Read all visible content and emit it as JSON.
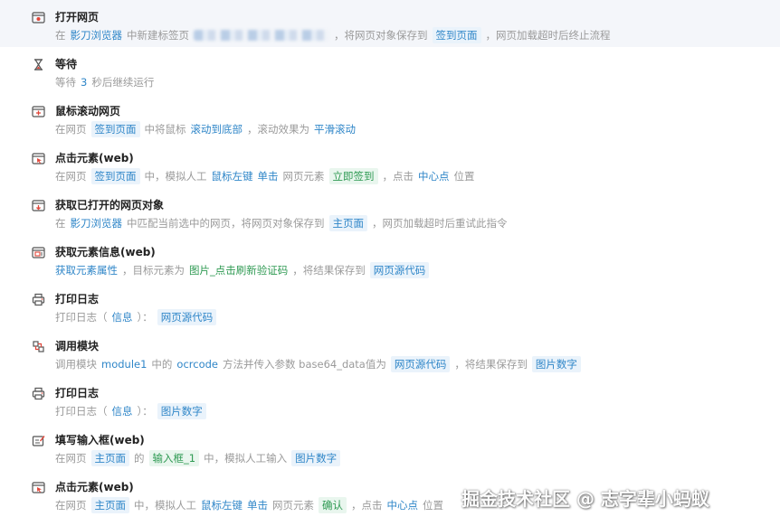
{
  "steps": [
    {
      "title": "打开网页",
      "icon": "browser-open-icon",
      "selected": true,
      "desc": [
        {
          "t": "txt",
          "v": "在"
        },
        {
          "t": "val",
          "v": "影刀浏览器"
        },
        {
          "t": "txt",
          "v": "中新建标签页"
        },
        {
          "t": "blur",
          "v": ""
        },
        {
          "t": "txt",
          "v": "，将网页对象保存到"
        },
        {
          "t": "chip",
          "v": "签到页面"
        },
        {
          "t": "txt",
          "v": "，网页加载超时后终止流程"
        }
      ]
    },
    {
      "title": "等待",
      "icon": "hourglass-icon",
      "desc": [
        {
          "t": "txt",
          "v": "等待"
        },
        {
          "t": "val",
          "v": "3"
        },
        {
          "t": "txt",
          "v": "秒后继续运行"
        }
      ]
    },
    {
      "title": "鼠标滚动网页",
      "icon": "scroll-page-icon",
      "desc": [
        {
          "t": "txt",
          "v": "在网页"
        },
        {
          "t": "chip",
          "v": "签到页面"
        },
        {
          "t": "txt",
          "v": "中将鼠标"
        },
        {
          "t": "val",
          "v": "滚动到底部"
        },
        {
          "t": "txt",
          "v": "，滚动效果为"
        },
        {
          "t": "val",
          "v": "平滑滚动"
        }
      ]
    },
    {
      "title": "点击元素(web)",
      "icon": "click-element-icon",
      "desc": [
        {
          "t": "txt",
          "v": "在网页"
        },
        {
          "t": "chip",
          "v": "签到页面"
        },
        {
          "t": "txt",
          "v": "中，模拟人工"
        },
        {
          "t": "val",
          "v": "鼠标左键"
        },
        {
          "t": "val",
          "v": "单击"
        },
        {
          "t": "txt",
          "v": "网页元素"
        },
        {
          "t": "chipg",
          "v": "立即签到"
        },
        {
          "t": "txt",
          "v": "，点击"
        },
        {
          "t": "val",
          "v": "中心点"
        },
        {
          "t": "txt",
          "v": "位置"
        }
      ]
    },
    {
      "title": "获取已打开的网页对象",
      "icon": "get-page-icon",
      "desc": [
        {
          "t": "txt",
          "v": "在"
        },
        {
          "t": "val",
          "v": "影刀浏览器"
        },
        {
          "t": "txt",
          "v": "中匹配当前选中的网页，将网页对象保存到"
        },
        {
          "t": "chip",
          "v": "主页面"
        },
        {
          "t": "txt",
          "v": "，网页加载超时后重试此指令"
        }
      ]
    },
    {
      "title": "获取元素信息(web)",
      "icon": "element-info-icon",
      "desc": [
        {
          "t": "val",
          "v": "获取元素属性"
        },
        {
          "t": "txt",
          "v": "，目标元素为"
        },
        {
          "t": "greentext",
          "v": "图片_点击刷新验证码"
        },
        {
          "t": "txt",
          "v": "，将结果保存到"
        },
        {
          "t": "chip",
          "v": "网页源代码"
        }
      ]
    },
    {
      "title": "打印日志",
      "icon": "printer-icon",
      "desc": [
        {
          "t": "txt",
          "v": "打印日志（"
        },
        {
          "t": "val",
          "v": "信息"
        },
        {
          "t": "txt",
          "v": "）："
        },
        {
          "t": "chip",
          "v": "网页源代码"
        }
      ]
    },
    {
      "title": "调用模块",
      "icon": "module-icon",
      "desc": [
        {
          "t": "txt",
          "v": "调用模块"
        },
        {
          "t": "val",
          "v": "module1"
        },
        {
          "t": "txt",
          "v": "中的"
        },
        {
          "t": "val",
          "v": "ocrcode"
        },
        {
          "t": "txt",
          "v": "方法并传入参数 base64_data值为"
        },
        {
          "t": "chip",
          "v": "网页源代码"
        },
        {
          "t": "txt",
          "v": "，将结果保存到"
        },
        {
          "t": "chip",
          "v": "图片数字"
        }
      ]
    },
    {
      "title": "打印日志",
      "icon": "printer-icon",
      "desc": [
        {
          "t": "txt",
          "v": "打印日志（"
        },
        {
          "t": "val",
          "v": "信息"
        },
        {
          "t": "txt",
          "v": "）："
        },
        {
          "t": "chip",
          "v": "图片数字"
        }
      ]
    },
    {
      "title": "填写输入框(web)",
      "icon": "edit-input-icon",
      "desc": [
        {
          "t": "txt",
          "v": "在网页"
        },
        {
          "t": "chip",
          "v": "主页面"
        },
        {
          "t": "txt",
          "v": "的"
        },
        {
          "t": "chipg",
          "v": "输入框_1"
        },
        {
          "t": "txt",
          "v": "中，模拟人工输入"
        },
        {
          "t": "chip",
          "v": "图片数字"
        }
      ]
    },
    {
      "title": "点击元素(web)",
      "icon": "click-element-icon",
      "desc": [
        {
          "t": "txt",
          "v": "在网页"
        },
        {
          "t": "chip",
          "v": "主页面"
        },
        {
          "t": "txt",
          "v": "中，模拟人工"
        },
        {
          "t": "val",
          "v": "鼠标左键"
        },
        {
          "t": "val",
          "v": "单击"
        },
        {
          "t": "txt",
          "v": "网页元素"
        },
        {
          "t": "chipg",
          "v": "确认"
        },
        {
          "t": "txt",
          "v": "，点击"
        },
        {
          "t": "val",
          "v": "中心点"
        },
        {
          "t": "txt",
          "v": "位置"
        }
      ]
    }
  ],
  "watermark": "掘金技术社区 @ 志字辈小蚂蚁"
}
